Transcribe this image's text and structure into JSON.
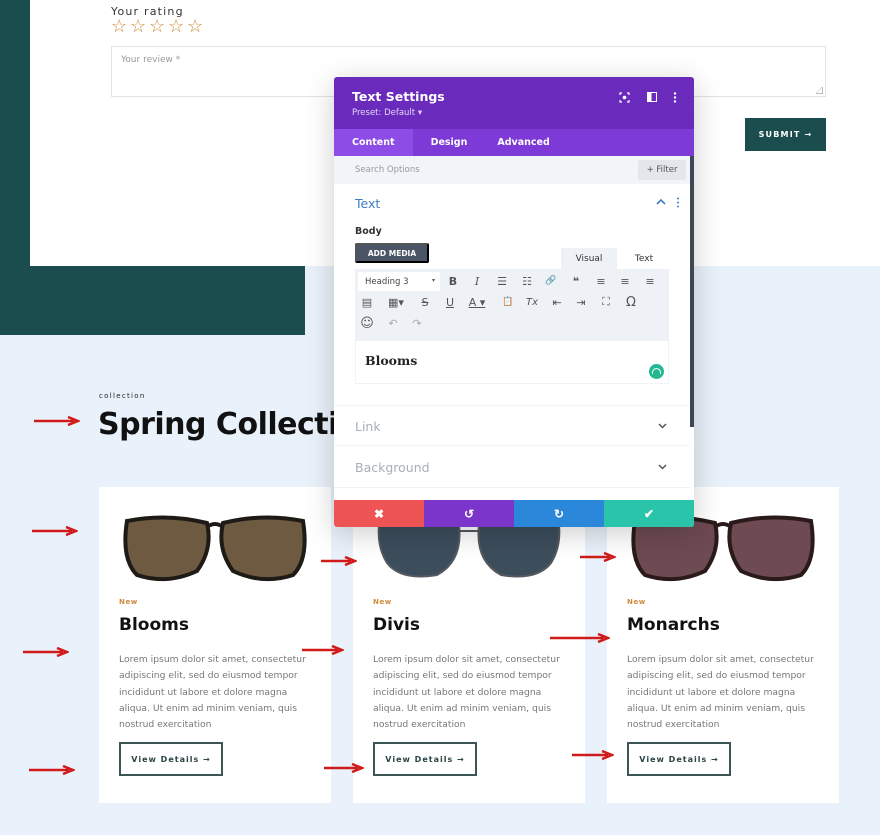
{
  "review_form": {
    "rating_label": "Your rating",
    "stars": [
      "☆",
      "☆",
      "☆",
      "☆",
      "☆"
    ],
    "review_placeholder": "Your review *",
    "submit_label": "SUBMIT →"
  },
  "collection": {
    "eyebrow": "collection",
    "title": "Spring Collection",
    "cards": [
      {
        "badge": "New",
        "title": "Blooms",
        "text": "Lorem ipsum dolor sit amet, consectetur adipiscing elit, sed do eiusmod tempor incididunt ut labore et dolore magna aliqua. Ut enim ad minim veniam, quis nostrud exercitation",
        "button": "View Details →",
        "lens_color": "#6e5a40",
        "frame_color": "#1e1a16"
      },
      {
        "badge": "New",
        "title": "Divis",
        "text": "Lorem ipsum dolor sit amet, consectetur adipiscing elit, sed do eiusmod tempor incididunt ut labore et dolore magna aliqua. Ut enim ad minim veniam, quis nostrud exercitation",
        "button": "View Details →",
        "lens_color": "#3c4d5c",
        "frame_color": "#555a60"
      },
      {
        "badge": "New",
        "title": "Monarchs",
        "text": "Lorem ipsum dolor sit amet, consectetur adipiscing elit, sed do eiusmod tempor incididunt ut labore et dolore magna aliqua. Ut enim ad minim veniam, quis nostrud exercitation",
        "button": "View Details →",
        "lens_color": "#6e4a52",
        "frame_color": "#2a1a1a"
      }
    ]
  },
  "modal": {
    "title": "Text Settings",
    "preset": "Preset: Default ▾",
    "header_icons": [
      "focus-icon",
      "split-view-icon",
      "more-icon"
    ],
    "tabs": [
      {
        "label": "Content",
        "active": true
      },
      {
        "label": "Design",
        "active": false
      },
      {
        "label": "Advanced",
        "active": false
      }
    ],
    "search_placeholder": "Search Options",
    "filter_label": "+ Filter",
    "text_section": {
      "title": "Text",
      "body_label": "Body",
      "add_media_label": "ADD MEDIA",
      "editor_tabs": {
        "visual": "Visual",
        "text": "Text"
      },
      "format_select": "Heading 3",
      "format_caret": "▾",
      "editor_content": "Blooms"
    },
    "toolbar_glyphs": {
      "bold": "B",
      "italic": "I",
      "bullet_list": "☰",
      "numbered_list": "☷",
      "link": "🔗",
      "blockquote": "❝",
      "align_left": "≡",
      "align_center": "≡",
      "align_right": "≡",
      "justify": "▤",
      "table": "▦▾",
      "strikethrough": "S",
      "underline": "U",
      "text_color": "A ▾",
      "paste_text": "📋",
      "clear_format": "Tx",
      "outdent": "⇤",
      "indent": "⇥",
      "fullscreen": "⛶",
      "special_char": "Ω",
      "emoji": "☺",
      "undo": "↶",
      "redo": "↷"
    },
    "sections": [
      {
        "title": "Link"
      },
      {
        "title": "Background"
      }
    ],
    "footer": {
      "cancel": "✖",
      "undo": "↺",
      "redo": "↻",
      "save": "✔"
    }
  },
  "colors": {
    "brand_dark_teal": "#1b4d4e",
    "accent_orange": "#d08a3c",
    "modal_purple": "#6a2bbd",
    "annotation_red": "#d11b1b"
  }
}
